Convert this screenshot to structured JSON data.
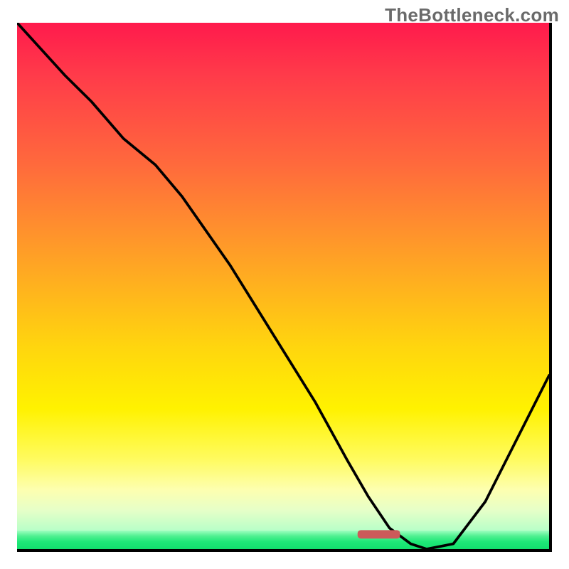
{
  "watermark": "TheBottleneck.com",
  "gradient_colors": {
    "top": "#ff1a4c",
    "mid_top": "#ff8e2e",
    "mid": "#ffd60e",
    "mid_bottom": "#fdffb0",
    "bottom_transition": "#9effc0",
    "bottom": "#12df6e"
  },
  "marker": {
    "color": "#cc5a5a",
    "x_pct": 68,
    "y_pct": 97.2,
    "width_pct": 8,
    "height_pct": 1.6,
    "rx": 6
  },
  "curve_color": "#000000",
  "chart_data": {
    "type": "line",
    "title": "",
    "xlabel": "",
    "ylabel": "",
    "xlim": [
      0,
      100
    ],
    "ylim": [
      0,
      100
    ],
    "grid": false,
    "series": [
      {
        "name": "bottleneck-curve",
        "x": [
          0,
          9,
          14,
          20,
          26,
          31,
          40,
          48,
          56,
          62,
          66,
          70,
          74,
          77,
          82,
          88,
          92,
          97,
          100
        ],
        "y": [
          100,
          90,
          85,
          78,
          73,
          67,
          54,
          41,
          28,
          17,
          10,
          4,
          1,
          0,
          1,
          9,
          17,
          27,
          33
        ]
      }
    ],
    "annotations": [
      {
        "type": "highlight-bar",
        "x_center": 72,
        "width": 8,
        "y": 2.8,
        "color": "#cc5a5a"
      }
    ]
  }
}
